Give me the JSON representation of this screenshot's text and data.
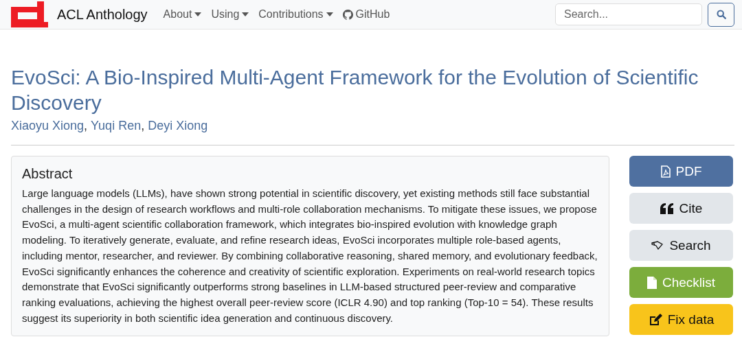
{
  "navbar": {
    "brand": "ACL Anthology",
    "links": [
      {
        "label": "About",
        "kind": "dropdown"
      },
      {
        "label": "Using",
        "kind": "dropdown"
      },
      {
        "label": "Contributions",
        "kind": "dropdown"
      },
      {
        "label": "GitHub",
        "kind": "github"
      }
    ],
    "search": {
      "placeholder": "Search..."
    }
  },
  "paper": {
    "title": "EvoSci: A Bio-Inspired Multi-Agent Framework for the Evolution of Scientific Discovery",
    "authors": [
      {
        "name": "Xiaoyu Xiong",
        "separator": ","
      },
      {
        "name": "Yuqi Ren",
        "separator": ","
      },
      {
        "name": "Deyi Xiong"
      }
    ]
  },
  "abstract": {
    "heading": "Abstract",
    "text": "Large language models (LLMs), have shown strong potential in scientific discovery, yet existing methods still face substantial challenges in the design of research workflows and multi-role collaboration mechanisms. To mitigate these issues, we propose EvoSci, a multi-agent scientific collaboration framework, which integrates bio-inspired evolution with knowledge graph modeling. To iteratively generate, evaluate, and refine research ideas, EvoSci incorporates multiple role-based agents, including mentor, researcher, and reviewer. By combining collaborative reasoning, shared memory, and evolutionary feedback, EvoSci significantly enhances the coherence and creativity of scientific exploration. Experiments on real-world research topics demonstrate that EvoSci significantly outperforms strong baselines in LLM-based structured peer-review and comparative ranking evaluations, achieving the highest overall peer-review score (ICLR 4.90) and top ranking (Top-10 = 54). These results suggest its superiority in both scientific idea generation and continuous discovery."
  },
  "actions": [
    {
      "label": "PDF",
      "kind": "pdf"
    },
    {
      "label": "Cite",
      "kind": "cite"
    },
    {
      "label": "Search",
      "kind": "search"
    },
    {
      "label": "Checklist",
      "kind": "checklist"
    },
    {
      "label": "Fix data",
      "kind": "fix"
    }
  ]
}
